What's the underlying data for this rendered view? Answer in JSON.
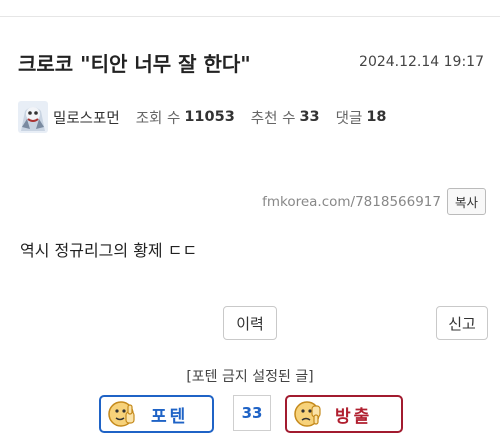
{
  "post": {
    "title": "크로코 \"티안 너무 잘 한다\"",
    "date": "2024.12.14 19:17",
    "author": "밀로스포먼",
    "views_label": "조회 수",
    "views": "11053",
    "recommend_label": "추천 수",
    "recommend": "33",
    "comments_label": "댓글",
    "comments": "18",
    "source_url": "fmkorea.com/7818566917",
    "copy_label": "복사",
    "body": "역시 정규리그의 황제 ㄷㄷ"
  },
  "actions": {
    "history_label": "이력",
    "report_label": "신고"
  },
  "vote": {
    "notice": "[포텐 금지 설정된 글]",
    "up_label": "포텐",
    "count": "33",
    "down_label": "방출",
    "up_color": "#1f63c6",
    "down_color": "#a21b2f"
  },
  "icons": {
    "avatar": "avatar-icon",
    "up": "thumbs-up-face-icon",
    "down": "thumbs-down-face-icon"
  }
}
